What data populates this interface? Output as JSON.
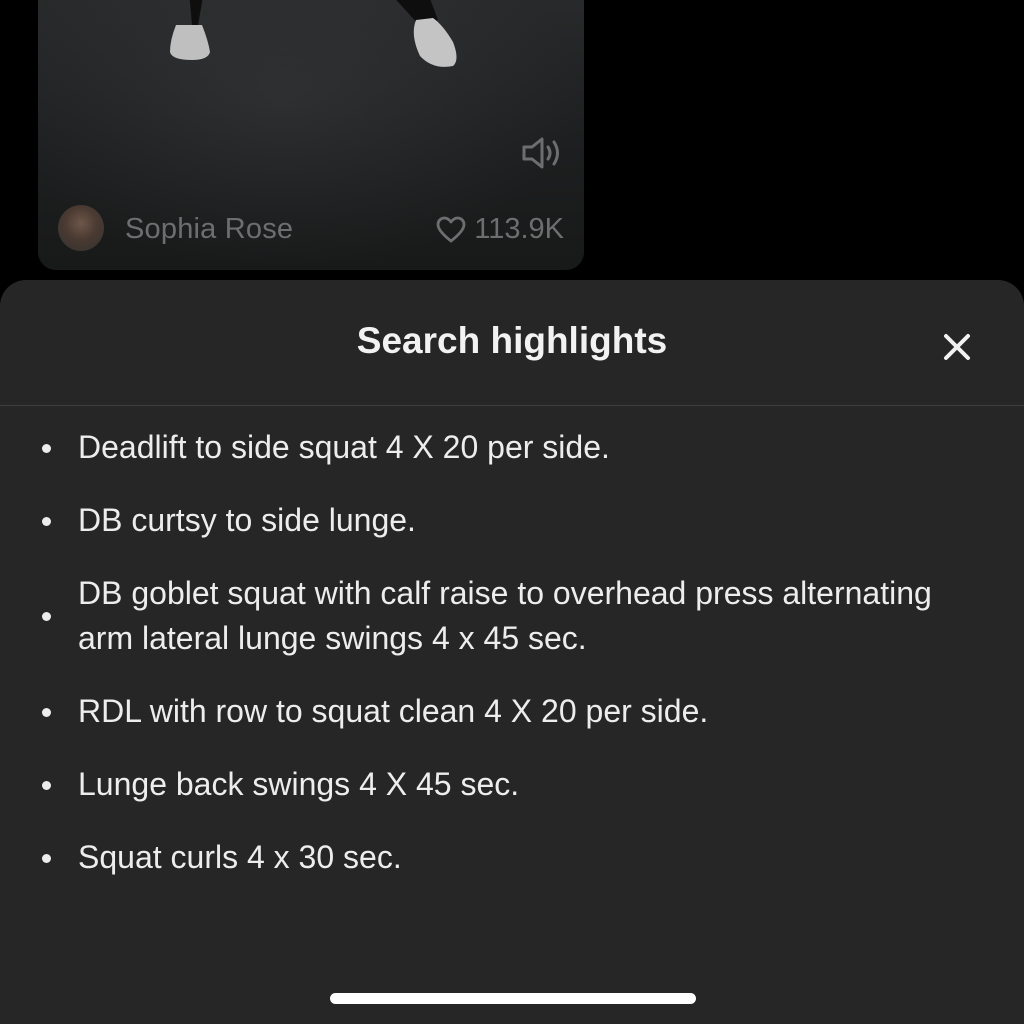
{
  "video_card": {
    "author_name": "Sophia Rose",
    "likes_count": "113.9K",
    "avatar_icon": "avatar",
    "sound_icon": "speaker-icon",
    "like_icon": "heart-icon"
  },
  "sheet": {
    "title": "Search highlights",
    "close_icon": "close-icon",
    "items": [
      "Deadlift to side squat 4 X 20 per side.",
      "DB curtsy to side lunge.",
      "DB goblet squat with calf raise to overhead press alternating arm lateral lunge swings 4 x 45 sec.",
      "RDL with row to squat clean 4 X 20 per side.",
      "Lunge back swings 4 X 45 sec.",
      "Squat curls 4 x 30 sec."
    ]
  },
  "colors": {
    "page_background": "#000000",
    "sheet_background": "#262626",
    "text_primary": "#ededed",
    "text_dimmed": "#6d6e70"
  }
}
